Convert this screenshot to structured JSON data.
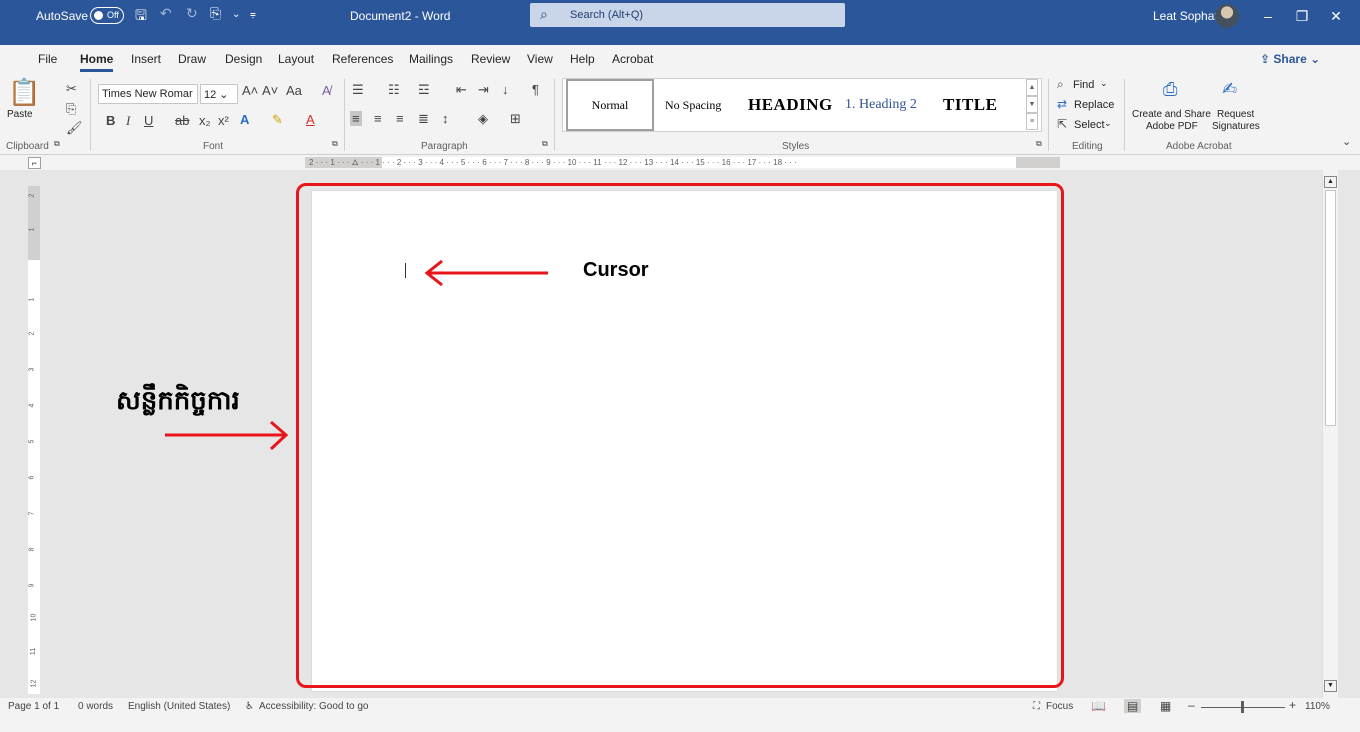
{
  "titlebar": {
    "autosave_label": "AutoSave",
    "autosave_state": "Off",
    "document_title": "Document2  -  Word",
    "search_placeholder": "Search (Alt+Q)",
    "user_name": "Leat Sophat"
  },
  "tabs": [
    "File",
    "Home",
    "Insert",
    "Draw",
    "Design",
    "Layout",
    "References",
    "Mailings",
    "Review",
    "View",
    "Help",
    "Acrobat"
  ],
  "share_label": "Share",
  "ribbon": {
    "clipboard": {
      "paste_label": "Paste",
      "group_label": "Clipboard"
    },
    "font": {
      "font_name": "Times New Romar",
      "font_size": "12",
      "group_label": "Font"
    },
    "paragraph": {
      "group_label": "Paragraph"
    },
    "styles": {
      "items": [
        "Normal",
        "No Spacing",
        "HEADING",
        "1.  Heading 2",
        "TITLE"
      ],
      "group_label": "Styles"
    },
    "editing": {
      "find": "Find",
      "replace": "Replace",
      "select": "Select",
      "group_label": "Editing"
    },
    "acrobat": {
      "create_share_1": "Create and Share",
      "create_share_2": "Adobe PDF",
      "request_1": "Request",
      "request_2": "Signatures",
      "group_label": "Adobe Acrobat"
    }
  },
  "ruler": {
    "horizontal_ticks": "2 · · · 1 · · · 🜂 · · · 1 · · · 2 · · · 3 · · · 4 · · · 5 · · · 6 · · · 7 · · · 8 · · · 9 · · · 10 · · · 11 · · · 12 · · · 13 · · · 14 · · · 15 · · · 16 · · · 17 · · · 18 · · ·",
    "vertical_numbers": [
      "2",
      "1",
      "1",
      "2",
      "3",
      "4",
      "5",
      "6",
      "7",
      "8",
      "9",
      "10",
      "11",
      "12"
    ]
  },
  "annotations": {
    "cursor_label": "Cursor",
    "workspace_label_khmer": "សន្លឹកកិច្ចការ",
    "highlight_color": "#e8161b"
  },
  "statusbar": {
    "page": "Page 1 of 1",
    "words": "0 words",
    "language": "English (United States)",
    "accessibility": "Accessibility: Good to go",
    "focus": "Focus",
    "zoom": "110%"
  },
  "colors": {
    "word_blue": "#2b579a",
    "ribbon_bg": "#f3f3f3",
    "canvas_bg": "#e6e6e6"
  }
}
